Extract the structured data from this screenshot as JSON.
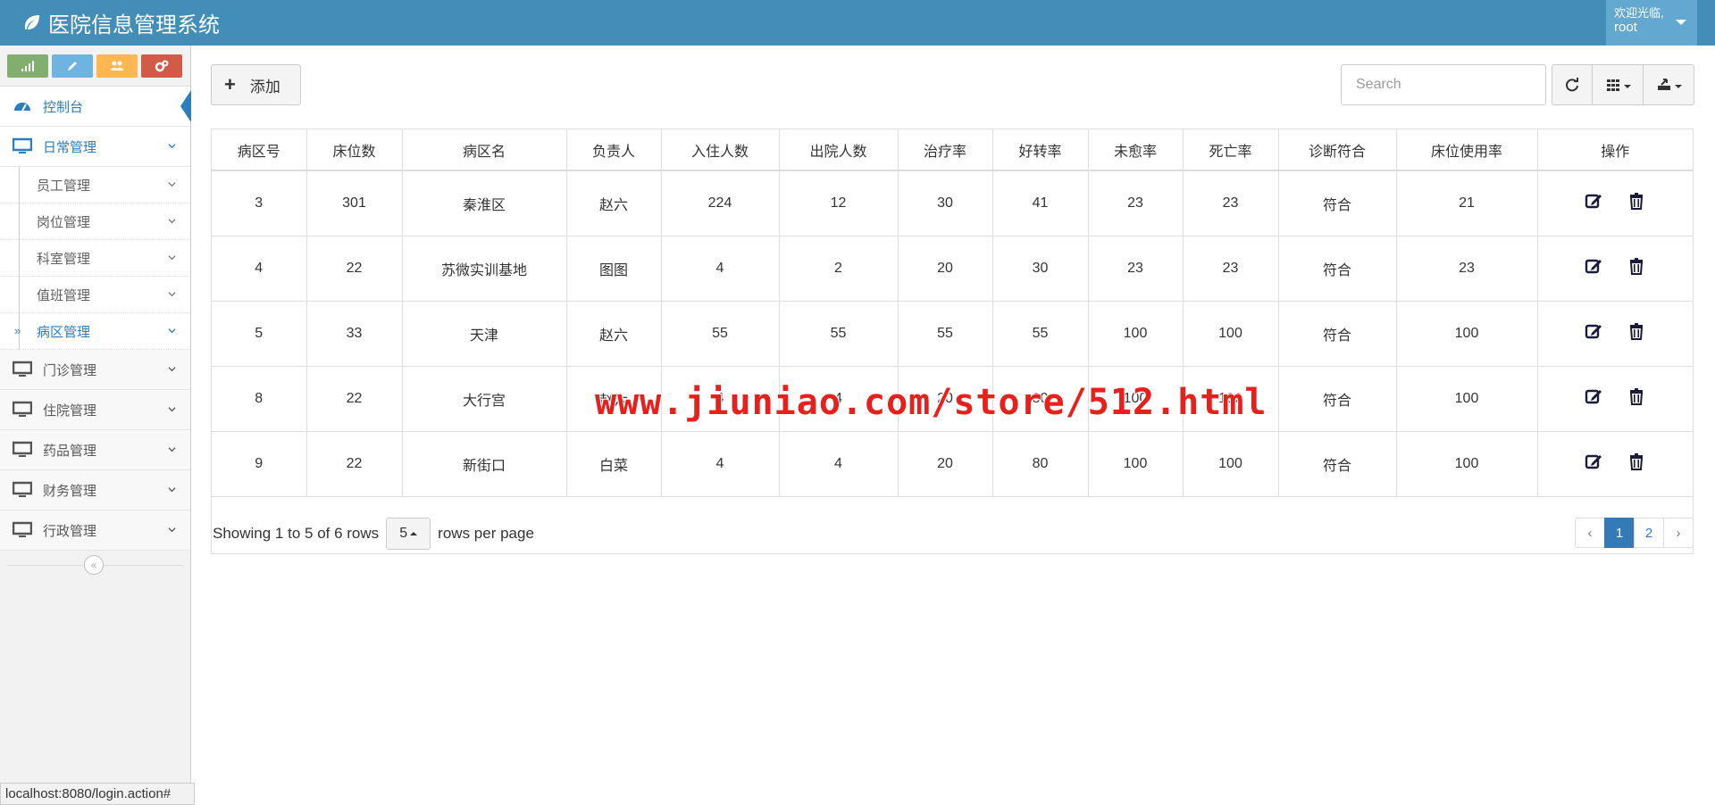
{
  "app": {
    "title": "医院信息管理系统"
  },
  "user": {
    "welcome": "欢迎光临,",
    "name": "root"
  },
  "sidebar": {
    "items": [
      {
        "label": "控制台"
      },
      {
        "label": "日常管理"
      },
      {
        "label": "门诊管理"
      },
      {
        "label": "住院管理"
      },
      {
        "label": "药品管理"
      },
      {
        "label": "财务管理"
      },
      {
        "label": "行政管理"
      }
    ],
    "sub_items": [
      {
        "label": "员工管理"
      },
      {
        "label": "岗位管理"
      },
      {
        "label": "科室管理"
      },
      {
        "label": "值班管理"
      },
      {
        "label": "病区管理",
        "marker": "»"
      }
    ],
    "collapse_glyph": "«"
  },
  "toolbar": {
    "add_label": "添加",
    "search_placeholder": "Search"
  },
  "table": {
    "headers": [
      "病区号",
      "床位数",
      "病区名",
      "负责人",
      "入住人数",
      "出院人数",
      "治疗率",
      "好转率",
      "未愈率",
      "死亡率",
      "诊断符合",
      "床位使用率",
      "操作"
    ],
    "rows": [
      [
        "3",
        "301",
        "秦淮区",
        "赵六",
        "224",
        "12",
        "30",
        "41",
        "23",
        "23",
        "符合",
        "21"
      ],
      [
        "4",
        "22",
        "苏微实训基地",
        "图图",
        "4",
        "2",
        "20",
        "30",
        "23",
        "23",
        "符合",
        "23"
      ],
      [
        "5",
        "33",
        "天津",
        "赵六",
        "55",
        "55",
        "55",
        "55",
        "100",
        "100",
        "符合",
        "100"
      ],
      [
        "8",
        "22",
        "大行宫",
        "赵六",
        "4",
        "4",
        "20",
        "80",
        "100",
        "100",
        "符合",
        "100"
      ],
      [
        "9",
        "22",
        "新街口",
        "白菜",
        "4",
        "4",
        "20",
        "80",
        "100",
        "100",
        "符合",
        "100"
      ]
    ]
  },
  "pagination": {
    "showing": "Showing 1 to 5 of 6 rows",
    "page_size": "5",
    "per_page": "rows per page",
    "prev": "‹",
    "pages": [
      "1",
      "2"
    ],
    "next": "›",
    "current": "1"
  },
  "watermark": "www.jiuniao.com/store/512.html",
  "statusbar": "localhost:8080/login.action#",
  "colors": {
    "header": "#438eb9",
    "accent": "#2b7dbc",
    "watermark": "#e8201c"
  }
}
